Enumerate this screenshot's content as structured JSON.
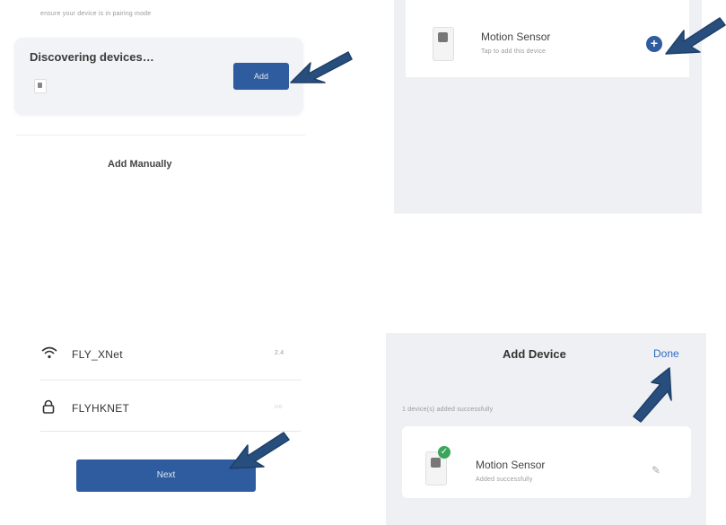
{
  "discover_panel": {
    "hint": "ensure your device is in pairing mode",
    "title": "Discovering devices…",
    "add_label": "Add",
    "add_manually_label": "Add Manually"
  },
  "device_found_panel": {
    "device_name": "Motion Sensor",
    "device_sub": "Tap to add this device",
    "add_icon": "plus-circle-icon"
  },
  "wifi_panel": {
    "wifi_icon": "wifi-icon",
    "network_name": "FLY_XNet",
    "network_meta": "2.4",
    "lock_icon": "lock-icon",
    "password": "FLYHKNET",
    "password_meta": "○○",
    "next_label": "Next"
  },
  "result_panel": {
    "title": "Add Device",
    "done_label": "Done",
    "status": "1 device(s) added successfully",
    "device_name": "Motion Sensor",
    "device_sub": "Added successfully",
    "edit_icon": "pencil-icon"
  },
  "colors": {
    "primary": "#2e5c9e",
    "arrow": "#284e7e",
    "success": "#3ba55c",
    "link": "#2e6bc7"
  }
}
